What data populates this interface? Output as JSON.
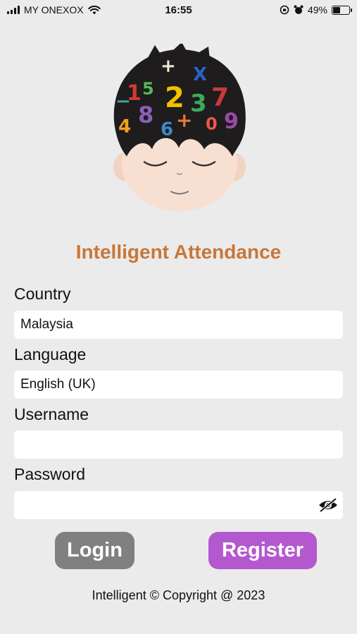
{
  "status_bar": {
    "carrier": "MY ONEXOX",
    "time": "16:55",
    "battery": "49%",
    "battery_level": 0.49
  },
  "app": {
    "title": "Intelligent Attendance",
    "logo_icon": "child-head-numbers-logo"
  },
  "form": {
    "country_label": "Country",
    "country_value": "Malaysia",
    "language_label": "Language",
    "language_value": "English (UK)",
    "username_label": "Username",
    "username_value": "",
    "password_label": "Password",
    "password_value": "",
    "password_toggle_icon": "eye-hidden-icon"
  },
  "buttons": {
    "login": "Login",
    "register": "Register"
  },
  "footer": {
    "copyright": "Intelligent © Copyright @ 2023"
  },
  "colors": {
    "title": "#c8773a",
    "login_bg": "#808080",
    "register_bg": "#b458cf",
    "page_bg": "#ebebeb"
  }
}
